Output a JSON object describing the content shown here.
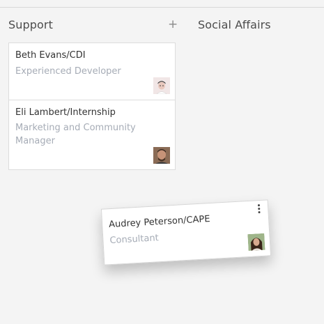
{
  "columns": [
    {
      "title": "Support",
      "add_symbol": "+",
      "cards": [
        {
          "name": "Beth Evans/CDI",
          "job": "Experienced Developer"
        },
        {
          "name": "Eli Lambert/Internship",
          "job_line1": "Marketing and Community",
          "job_line2": "Manager"
        }
      ]
    },
    {
      "title": "Social Affairs"
    }
  ],
  "dragged_card": {
    "name": "Audrey Peterson/CAPE",
    "job": "Consultant"
  },
  "icons": {
    "add": "plus-icon",
    "menu": "kebab-menu-icon"
  },
  "colors": {
    "background": "#f4f4f4",
    "card": "#ffffff",
    "muted_text": "#a6acb6"
  }
}
